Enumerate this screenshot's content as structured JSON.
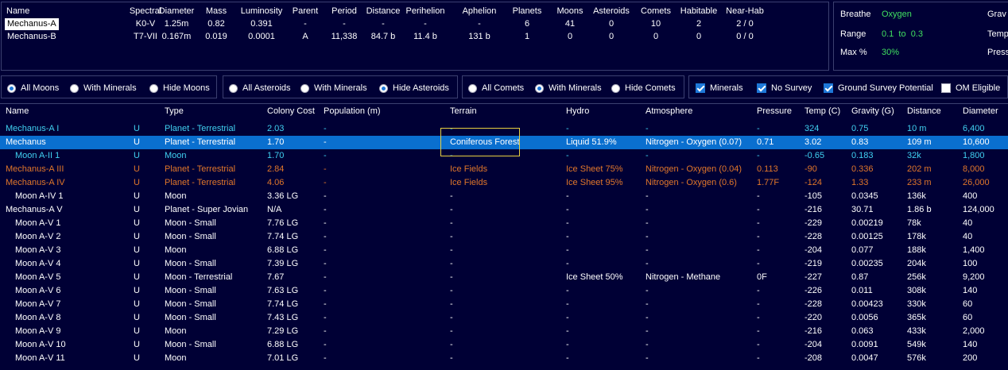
{
  "stars": {
    "headers": [
      "Name",
      "Spectral",
      "Diameter",
      "Mass",
      "Luminosity",
      "Parent",
      "Period",
      "Distance",
      "Perihelion",
      "Aphelion",
      "Planets",
      "Moons",
      "Asteroids",
      "Comets",
      "Habitable",
      "Near-Hab"
    ],
    "rows": [
      [
        "Mechanus-A",
        "K0-V",
        "1.25m",
        "0.82",
        "0.391",
        "-",
        "-",
        "-",
        "-",
        "-",
        "6",
        "41",
        "0",
        "10",
        "2",
        "2 / 0"
      ],
      [
        "Mechanus-B",
        "T7-VII",
        "0.167m",
        "0.019",
        "0.0001",
        "A",
        "11,338",
        "84.7 b",
        "11.4 b",
        "131 b",
        "1",
        "0",
        "0",
        "0",
        "0",
        "0 / 0"
      ]
    ]
  },
  "env": {
    "breathe_label": "Breathe",
    "breathe_value": "Oxygen",
    "range_label": "Range",
    "range_value": "0.1  to  0.3",
    "max_label": "Max %",
    "max_value": "30%",
    "grav_label": "Grav",
    "temp_label": "Temp",
    "press_label": "Press"
  },
  "filters": {
    "moons": [
      "All Moons",
      "With Minerals",
      "Hide Moons"
    ],
    "moons_selected": 0,
    "asteroids": [
      "All Asteroids",
      "With Minerals",
      "Hide Asteroids"
    ],
    "asteroids_selected": 2,
    "comets": [
      "All Comets",
      "With Minerals",
      "Hide Comets"
    ],
    "comets_selected": 1,
    "checks": [
      {
        "label": "Minerals",
        "checked": true
      },
      {
        "label": "No Survey",
        "checked": true
      },
      {
        "label": "Ground Survey Potential",
        "checked": true
      },
      {
        "label": "OM Eligible",
        "checked": false
      }
    ]
  },
  "colors": {
    "cyan": "#40d0f0",
    "orange": "#e0762a",
    "white": "#ffffff",
    "selected_bg": "#0a6fcf",
    "green": "#40e060"
  },
  "bodies": {
    "headers": [
      "Name",
      "",
      "Type",
      "Colony Cost",
      "Population (m)",
      "Terrain",
      "Hydro",
      "Atmosphere",
      "Pressure",
      "Temp (C)",
      "Gravity (G)",
      "Distance",
      "Diameter"
    ],
    "rows": [
      {
        "indent": 0,
        "style": "cyan",
        "cells": [
          "Mechanus-A I",
          "U",
          "Planet - Terrestrial",
          "2.03",
          "-",
          "-",
          "-",
          "-",
          "-",
          "324",
          "0.75",
          "10 m",
          "6,400"
        ]
      },
      {
        "indent": 0,
        "style": "selected",
        "cells": [
          "Mechanus",
          "U",
          "Planet - Terrestrial",
          "1.70",
          "-",
          "Coniferous Forest",
          "Liquid 51.9%",
          "Nitrogen - Oxygen (0.07)",
          "0.71",
          "3.02",
          "0.83",
          "109 m",
          "10,600"
        ]
      },
      {
        "indent": 1,
        "style": "cyan",
        "cells": [
          "Moon A-II 1",
          "U",
          "Moon",
          "1.70",
          "-",
          "-",
          "-",
          "-",
          "-",
          "-0.65",
          "0.183",
          "32k",
          "1,800"
        ]
      },
      {
        "indent": 0,
        "style": "orange",
        "cells": [
          "Mechanus-A III",
          "U",
          "Planet - Terrestrial",
          "2.84",
          "-",
          "Ice Fields",
          "Ice Sheet 75%",
          "Nitrogen - Oxygen (0.04)",
          "0.113",
          "-90",
          "0.336",
          "202 m",
          "8,000"
        ]
      },
      {
        "indent": 0,
        "style": "orange",
        "cells": [
          "Mechanus-A IV",
          "U",
          "Planet - Terrestrial",
          "4.06",
          "-",
          "Ice Fields",
          "Ice Sheet 95%",
          "Nitrogen - Oxygen (0.6)",
          "1.77F",
          "-124",
          "1.33",
          "233 m",
          "26,000"
        ]
      },
      {
        "indent": 1,
        "style": "white",
        "cells": [
          "Moon A-IV 1",
          "U",
          "Moon",
          "3.36 LG",
          "-",
          "-",
          "-",
          "-",
          "-",
          "-105",
          "0.0345",
          "136k",
          "400"
        ]
      },
      {
        "indent": 0,
        "style": "white",
        "cells": [
          "Mechanus-A V",
          "U",
          "Planet - Super Jovian",
          "N/A",
          "-",
          "-",
          "-",
          "-",
          "-",
          "-216",
          "30.71",
          "1.86 b",
          "124,000"
        ]
      },
      {
        "indent": 1,
        "style": "white",
        "cells": [
          "Moon A-V 1",
          "U",
          "Moon - Small",
          "7.76 LG",
          "-",
          "-",
          "-",
          "-",
          "-",
          "-229",
          "0.00219",
          "78k",
          "40"
        ]
      },
      {
        "indent": 1,
        "style": "white",
        "cells": [
          "Moon A-V 2",
          "U",
          "Moon - Small",
          "7.74 LG",
          "-",
          "-",
          "-",
          "-",
          "-",
          "-228",
          "0.00125",
          "178k",
          "40"
        ]
      },
      {
        "indent": 1,
        "style": "white",
        "cells": [
          "Moon A-V 3",
          "U",
          "Moon",
          "6.88 LG",
          "-",
          "-",
          "-",
          "-",
          "-",
          "-204",
          "0.077",
          "188k",
          "1,400"
        ]
      },
      {
        "indent": 1,
        "style": "white",
        "cells": [
          "Moon A-V 4",
          "U",
          "Moon - Small",
          "7.39 LG",
          "-",
          "-",
          "-",
          "-",
          "-",
          "-219",
          "0.00235",
          "204k",
          "100"
        ]
      },
      {
        "indent": 1,
        "style": "white",
        "cells": [
          "Moon A-V 5",
          "U",
          "Moon - Terrestrial",
          "7.67",
          "-",
          "-",
          "Ice Sheet 50%",
          "Nitrogen - Methane",
          "0F",
          "-227",
          "0.87",
          "256k",
          "9,200"
        ]
      },
      {
        "indent": 1,
        "style": "white",
        "cells": [
          "Moon A-V 6",
          "U",
          "Moon - Small",
          "7.63 LG",
          "-",
          "-",
          "-",
          "-",
          "-",
          "-226",
          "0.011",
          "308k",
          "140"
        ]
      },
      {
        "indent": 1,
        "style": "white",
        "cells": [
          "Moon A-V 7",
          "U",
          "Moon - Small",
          "7.74 LG",
          "-",
          "-",
          "-",
          "-",
          "-",
          "-228",
          "0.00423",
          "330k",
          "60"
        ]
      },
      {
        "indent": 1,
        "style": "white",
        "cells": [
          "Moon A-V 8",
          "U",
          "Moon - Small",
          "7.43 LG",
          "-",
          "-",
          "-",
          "-",
          "-",
          "-220",
          "0.0056",
          "365k",
          "60"
        ]
      },
      {
        "indent": 1,
        "style": "white",
        "cells": [
          "Moon A-V 9",
          "U",
          "Moon",
          "7.29 LG",
          "-",
          "-",
          "-",
          "-",
          "-",
          "-216",
          "0.063",
          "433k",
          "2,000"
        ]
      },
      {
        "indent": 1,
        "style": "white",
        "cells": [
          "Moon A-V 10",
          "U",
          "Moon - Small",
          "6.88 LG",
          "-",
          "-",
          "-",
          "-",
          "-",
          "-204",
          "0.0091",
          "549k",
          "140"
        ]
      },
      {
        "indent": 1,
        "style": "white",
        "cells": [
          "Moon A-V 11",
          "U",
          "Moon",
          "7.01 LG",
          "-",
          "-",
          "-",
          "-",
          "-",
          "-208",
          "0.0047",
          "576k",
          "200"
        ]
      }
    ]
  }
}
